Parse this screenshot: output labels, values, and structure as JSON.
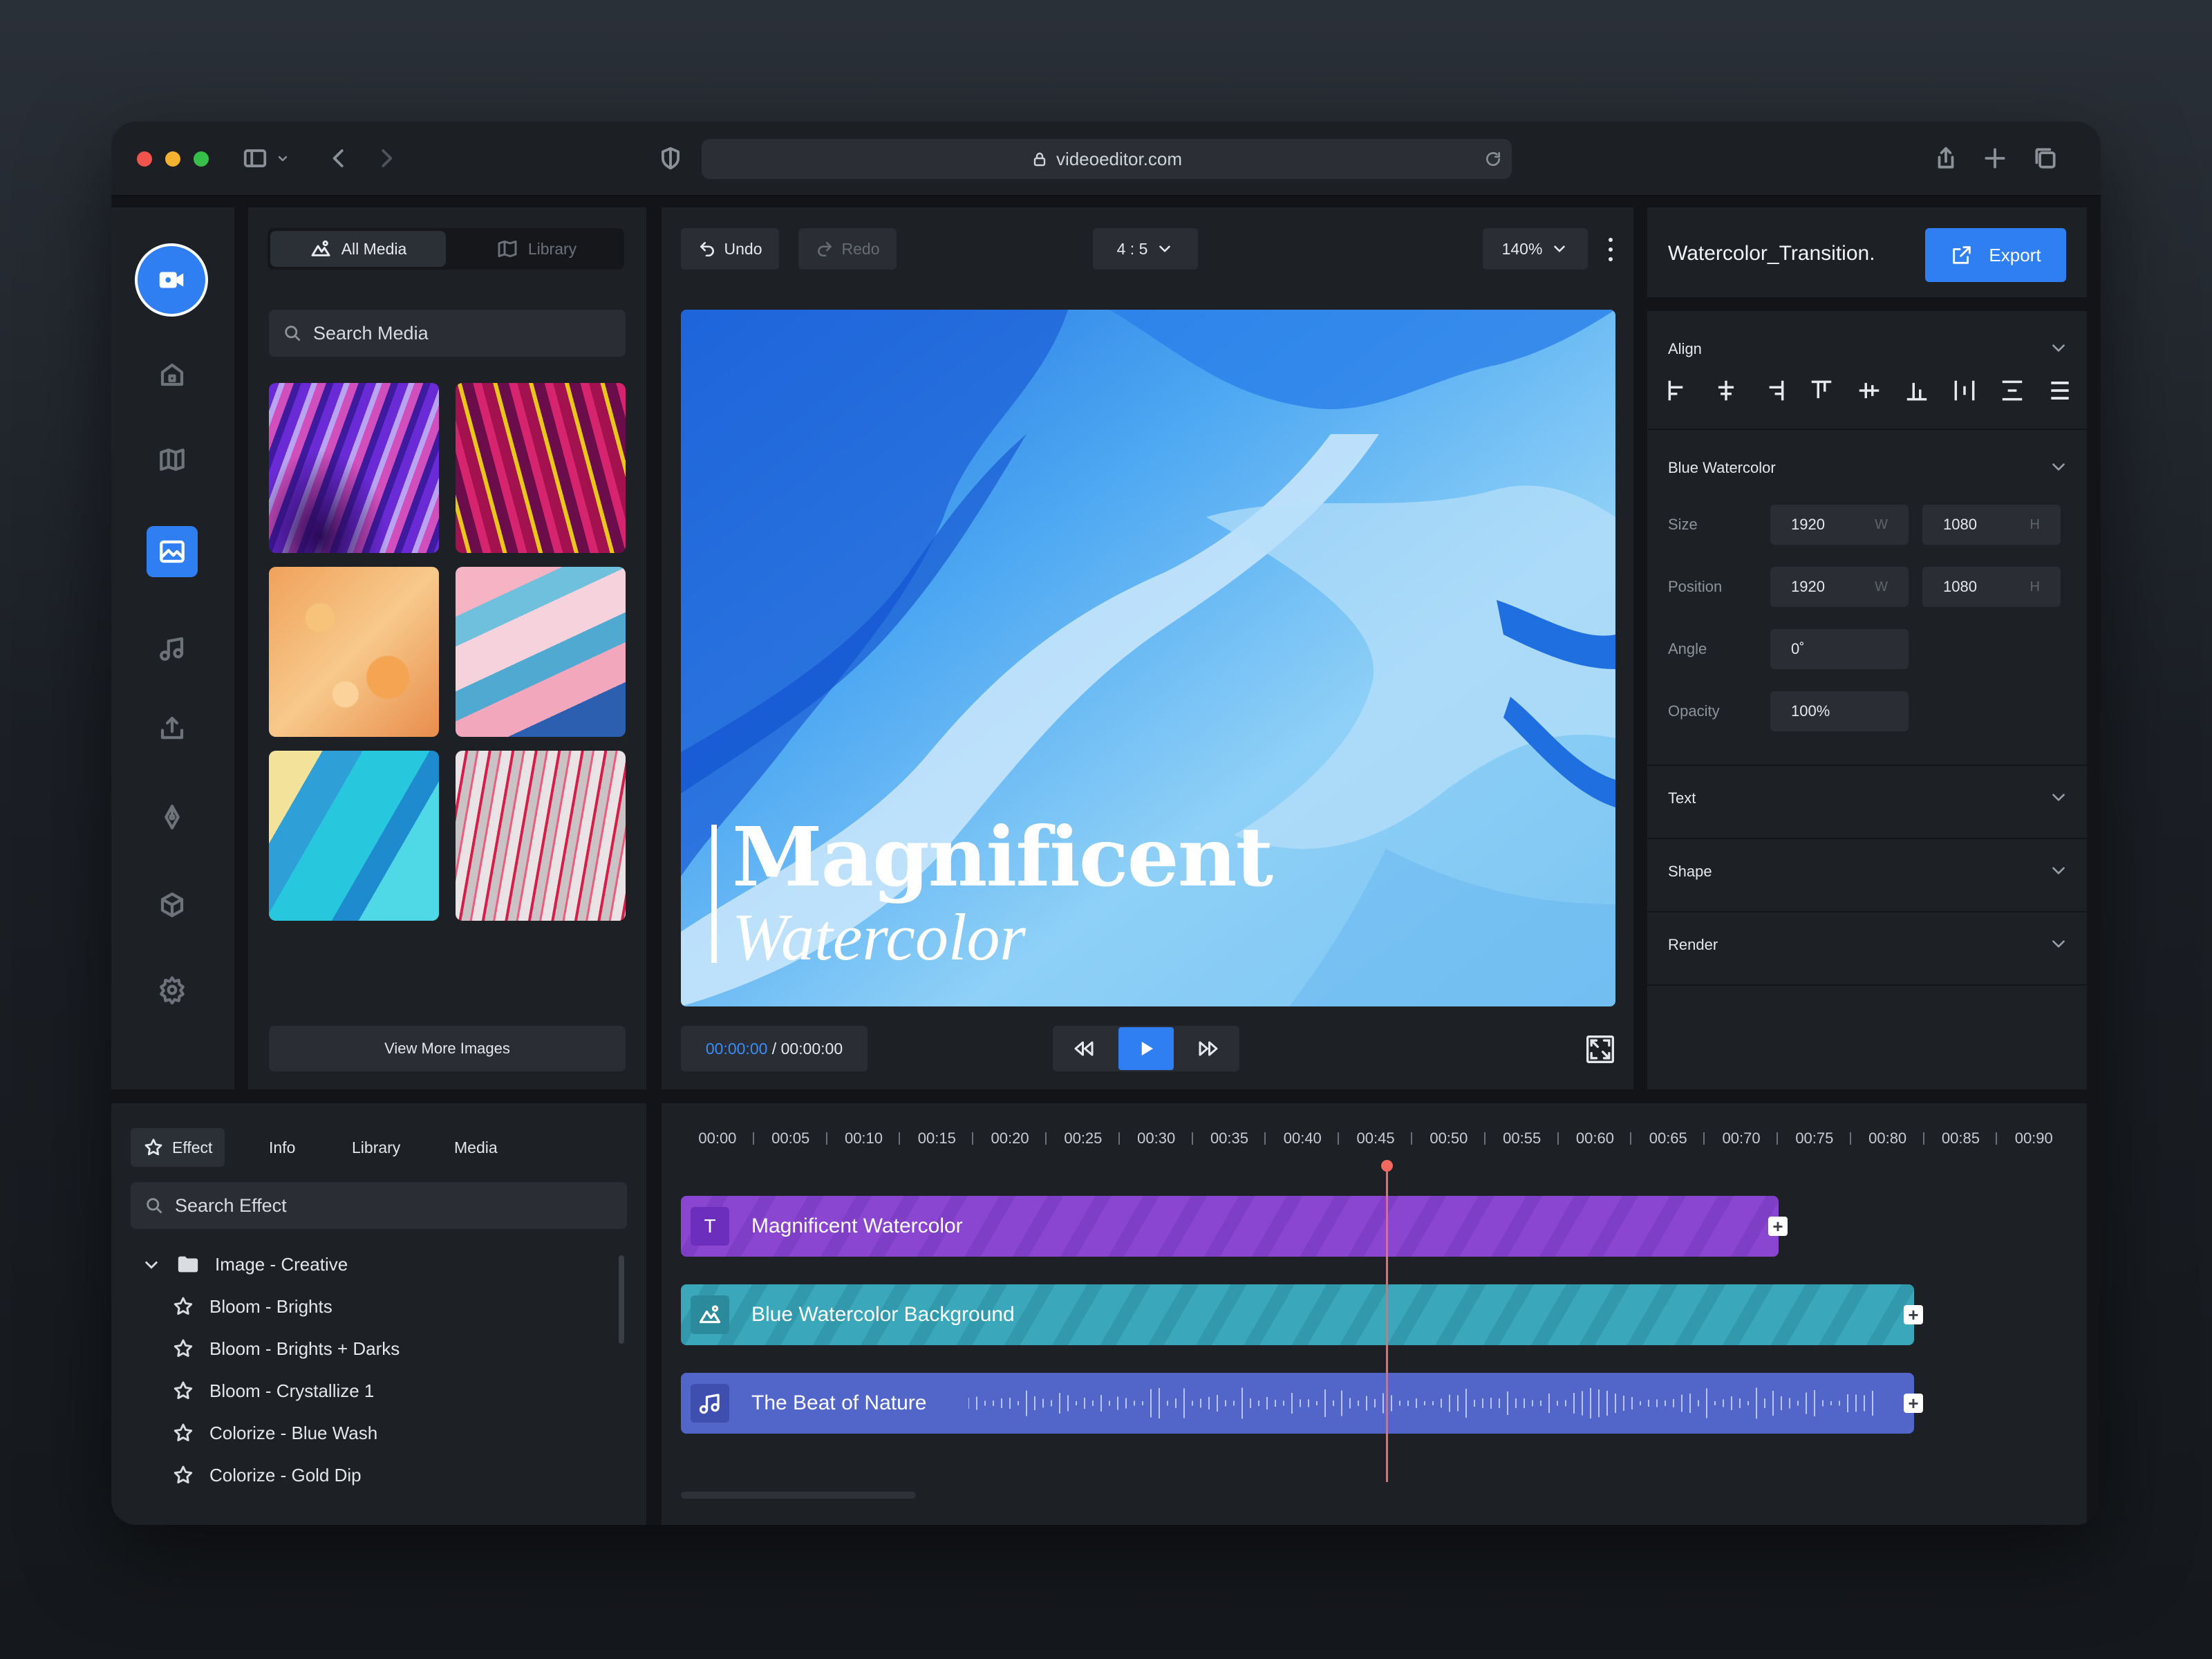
{
  "browser": {
    "url": "videoeditor.com"
  },
  "rail": {
    "items": [
      "home",
      "book",
      "image",
      "music",
      "upload",
      "pen",
      "cube",
      "settings"
    ]
  },
  "media": {
    "tabs": [
      "All Media",
      "Library"
    ],
    "search_placeholder": "Search Media",
    "view_more": "View More Images"
  },
  "canvas": {
    "undo": "Undo",
    "redo": "Redo",
    "ratio": "4 : 5",
    "zoom": "140%",
    "title_main": "Magnificent",
    "title_sub": "Watercolor",
    "time_current": "00:00:00",
    "time_total": " / 00:00:00"
  },
  "props": {
    "project_name": "Watercolor_Transition.",
    "export": "Export",
    "align_title": "Align",
    "layer_title": "Blue Watercolor",
    "size_label": "Size",
    "size_w": "1920",
    "size_h": "1080",
    "position_label": "Position",
    "pos_w": "1920",
    "pos_h": "1080",
    "w_unit": "W",
    "h_unit": "H",
    "angle_label": "Angle",
    "angle": "0˚",
    "opacity_label": "Opacity",
    "opacity": "100%",
    "text_title": "Text",
    "shape_title": "Shape",
    "render_title": "Render"
  },
  "effects": {
    "tabs": [
      "Effect",
      "Info",
      "Library",
      "Media"
    ],
    "search_placeholder": "Search Effect",
    "folder": "Image - Creative",
    "items": [
      "Bloom - Brights",
      "Bloom - Brights + Darks",
      "Bloom - Crystallize 1",
      "Colorize - Blue Wash",
      "Colorize - Gold Dip"
    ]
  },
  "timeline": {
    "ticks": [
      "00:00",
      "00:05",
      "00:10",
      "00:15",
      "00:20",
      "00:25",
      "00:30",
      "00:35",
      "00:40",
      "00:45",
      "00:50",
      "00:55",
      "00:60",
      "00:65",
      "00:70",
      "00:75",
      "00:80",
      "00:85",
      "00:90"
    ],
    "tracks": [
      {
        "label": "Magnificent Watercolor",
        "icon": "T",
        "color": "#8b47d1"
      },
      {
        "label": "Blue Watercolor Background",
        "icon": "image",
        "color": "#3aa6b9"
      },
      {
        "label": "The Beat of Nature",
        "icon": "music",
        "color": "#5264c9"
      }
    ]
  },
  "colors": {
    "accent": "#2f7ef2",
    "playhead": "#f26a5e"
  }
}
